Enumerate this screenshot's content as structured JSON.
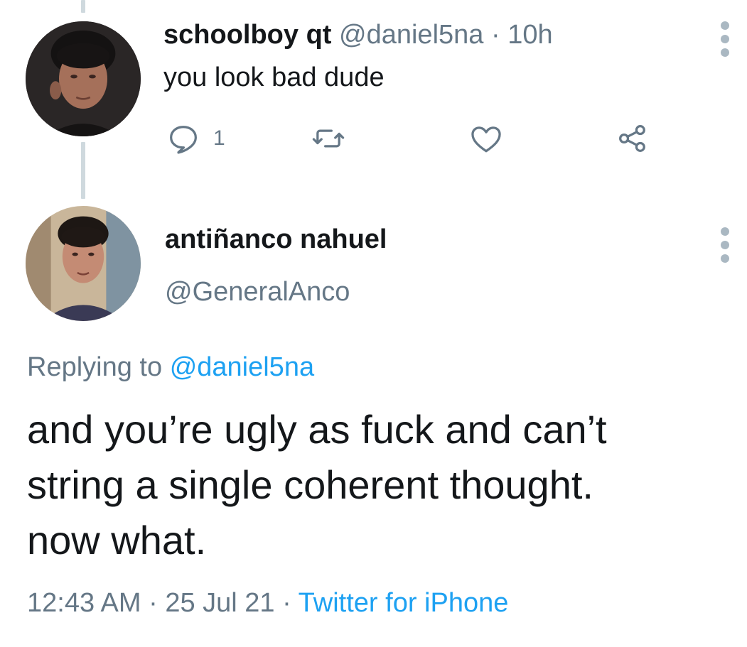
{
  "reply_tweet": {
    "author_name": "schoolboy qt",
    "author_handle": "@daniel5na",
    "separator": "·",
    "time": "10h",
    "text": "you look bad dude",
    "reply_count": "1",
    "avatar_icon": "user-photo-icon"
  },
  "main_tweet": {
    "author_name": "antiñanco nahuel",
    "author_handle": "@GeneralAnco",
    "replying_to_label": "Replying to",
    "replying_to_handle": "@daniel5na",
    "text": "and you’re ugly as fuck and can’t\nstring a single coherent thought.\nnow what.",
    "time": "12:43 AM",
    "separator": "·",
    "date": "25 Jul 21",
    "source": "Twitter for iPhone",
    "avatar_icon": "user-photo-icon"
  },
  "colors": {
    "text": "#14171a",
    "muted": "#657786",
    "link": "#1da1f2",
    "thread_line": "#cfd9de"
  }
}
